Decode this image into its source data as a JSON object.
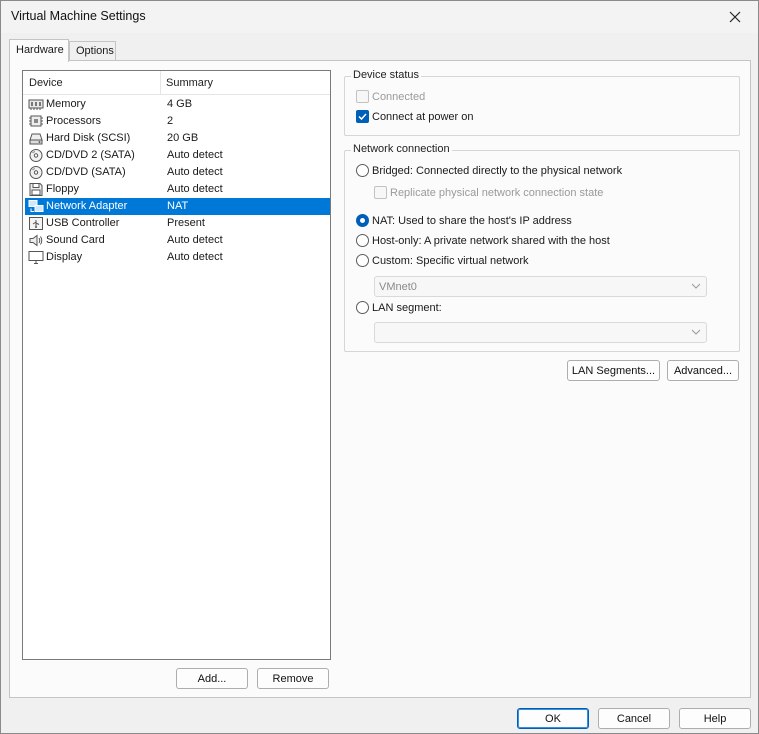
{
  "window": {
    "title": "Virtual Machine Settings"
  },
  "tabs": [
    {
      "label": "Hardware",
      "active": true
    },
    {
      "label": "Options",
      "active": false
    }
  ],
  "device_list": {
    "columns": [
      "Device",
      "Summary"
    ],
    "rows": [
      {
        "name": "Memory",
        "summary": "4 GB",
        "icon": "memory-icon"
      },
      {
        "name": "Processors",
        "summary": "2",
        "icon": "processor-icon"
      },
      {
        "name": "Hard Disk (SCSI)",
        "summary": "20 GB",
        "icon": "hard-disk-icon"
      },
      {
        "name": "CD/DVD 2 (SATA)",
        "summary": "Auto detect",
        "icon": "cd-dvd-icon"
      },
      {
        "name": "CD/DVD (SATA)",
        "summary": "Auto detect",
        "icon": "cd-dvd-icon"
      },
      {
        "name": "Floppy",
        "summary": "Auto detect",
        "icon": "floppy-icon"
      },
      {
        "name": "Network Adapter",
        "summary": "NAT",
        "icon": "network-adapter-icon",
        "selected": true
      },
      {
        "name": "USB Controller",
        "summary": "Present",
        "icon": "usb-icon"
      },
      {
        "name": "Sound Card",
        "summary": "Auto detect",
        "icon": "speaker-icon"
      },
      {
        "name": "Display",
        "summary": "Auto detect",
        "icon": "monitor-icon"
      }
    ]
  },
  "list_buttons": {
    "add": "Add...",
    "remove": "Remove"
  },
  "device_status": {
    "title": "Device status",
    "connected": "Connected",
    "connect_power_on": "Connect at power on"
  },
  "network": {
    "title": "Network connection",
    "bridged": "Bridged: Connected directly to the physical network",
    "replicate": "Replicate physical network connection state",
    "nat": "NAT: Used to share the host's IP address",
    "host_only": "Host-only: A private network shared with the host",
    "custom": "Custom: Specific virtual network",
    "vmnet_value": "VMnet0",
    "lan_segment": "LAN segment:",
    "lan_segment_value": ""
  },
  "network_buttons": {
    "lan_segments": "LAN Segments...",
    "advanced": "Advanced..."
  },
  "footer": {
    "ok": "OK",
    "cancel": "Cancel",
    "help": "Help"
  },
  "colors": {
    "accent": "#005fb8",
    "selection": "#0078d7"
  }
}
